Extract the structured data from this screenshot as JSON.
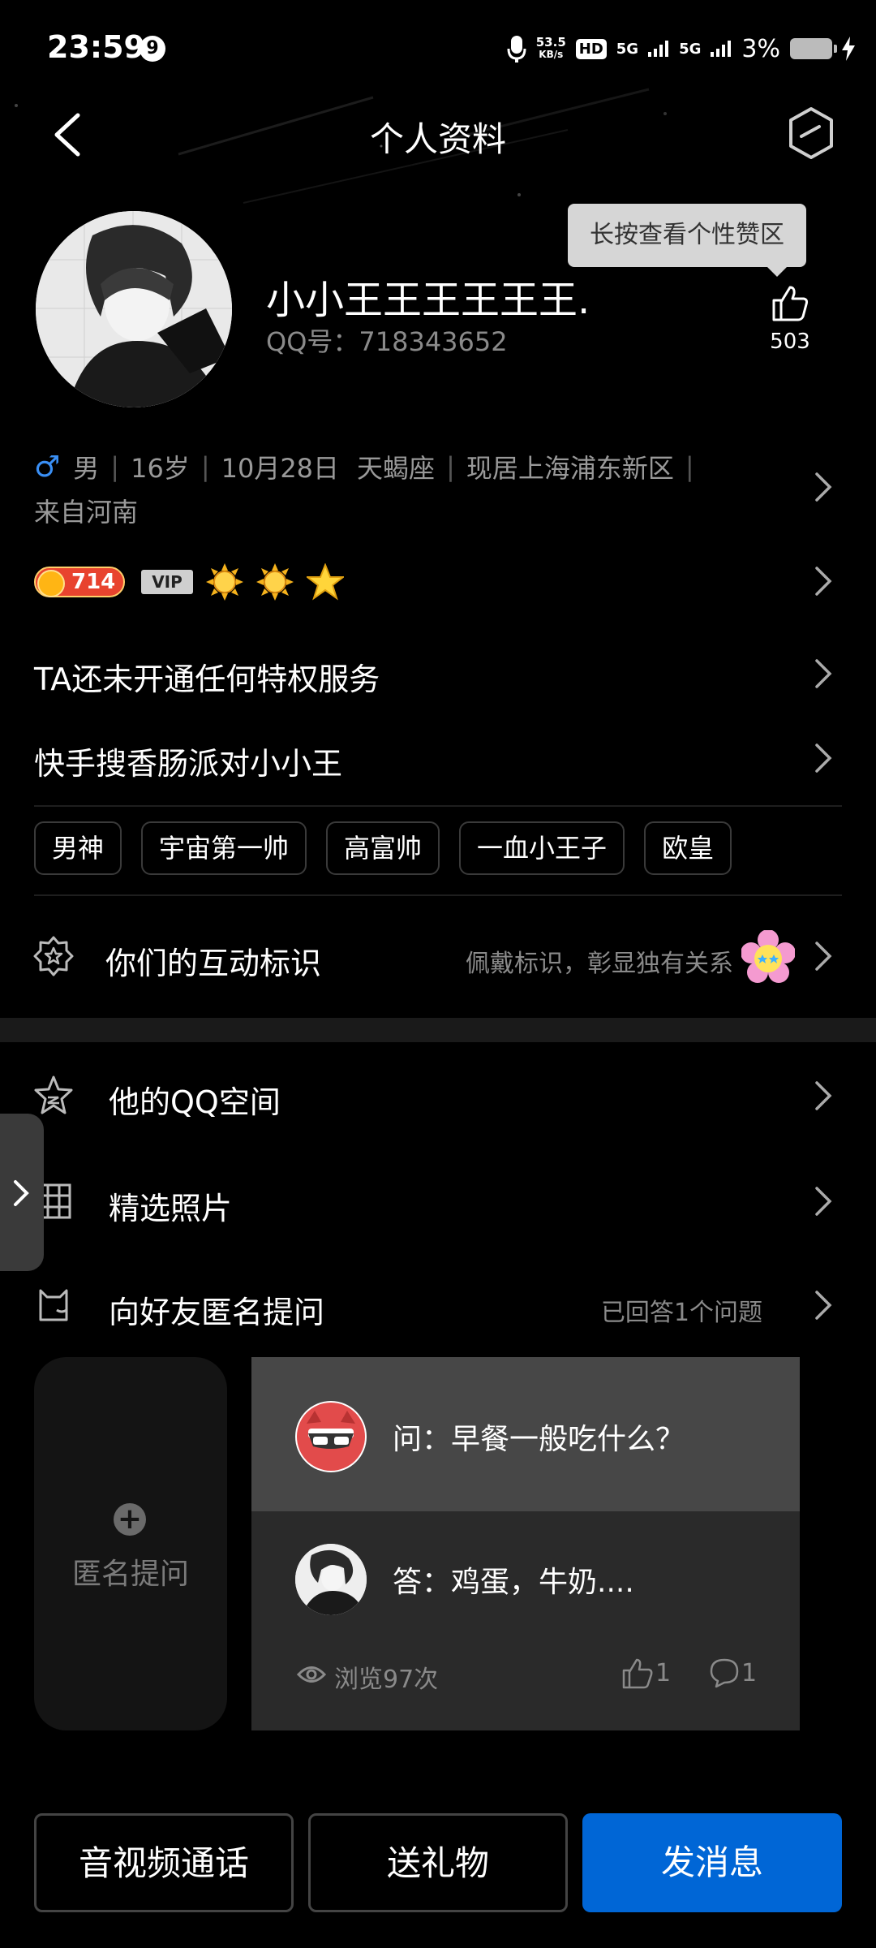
{
  "status_bar": {
    "time": "23:59",
    "notification_count": "9",
    "net_speed_value": "53.5",
    "net_speed_unit": "KB/s",
    "hd_label": "HD",
    "signal1": "5G",
    "signal2": "5G",
    "battery_percent": "3%"
  },
  "header": {
    "title": "个人资料"
  },
  "profile": {
    "nickname": "小小王王王王王王.",
    "qq_number": "QQ号：718343652",
    "tooltip": "长按查看个性赞区",
    "like_count": "503"
  },
  "info": {
    "gender": "男",
    "age": "16岁",
    "birthday": "10月28日",
    "zodiac": "天蝎座",
    "location": "现居上海浦东新区",
    "hometown": "来自河南"
  },
  "badges": {
    "coin_level": "714",
    "vip_label": "VIP"
  },
  "rows": {
    "privilege": "TA还未开通任何特权服务",
    "signature": "快手搜香肠派对小小王"
  },
  "tags": [
    "男神",
    "宇宙第一帅",
    "高富帅",
    "一血小王子",
    "欧皇"
  ],
  "interaction": {
    "label": "你们的互动标识",
    "hint": "佩戴标识，彰显独有关系"
  },
  "menu": {
    "qzone": "他的QQ空间",
    "photos": "精选照片",
    "anon_question": "向好友匿名提问",
    "answered_count": "已回答1个问题"
  },
  "qa": {
    "ask_label": "匿名提问",
    "question": "问：早餐一般吃什么？",
    "answer": "答：鸡蛋，牛奶....",
    "views": "浏览97次",
    "likes": "1",
    "comments": "1"
  },
  "actions": {
    "call": "音视频通话",
    "gift": "送礼物",
    "message": "发消息"
  },
  "colors": {
    "accent_blue": "#0066d6",
    "male_blue": "#3a8ff5",
    "background": "#000000"
  }
}
